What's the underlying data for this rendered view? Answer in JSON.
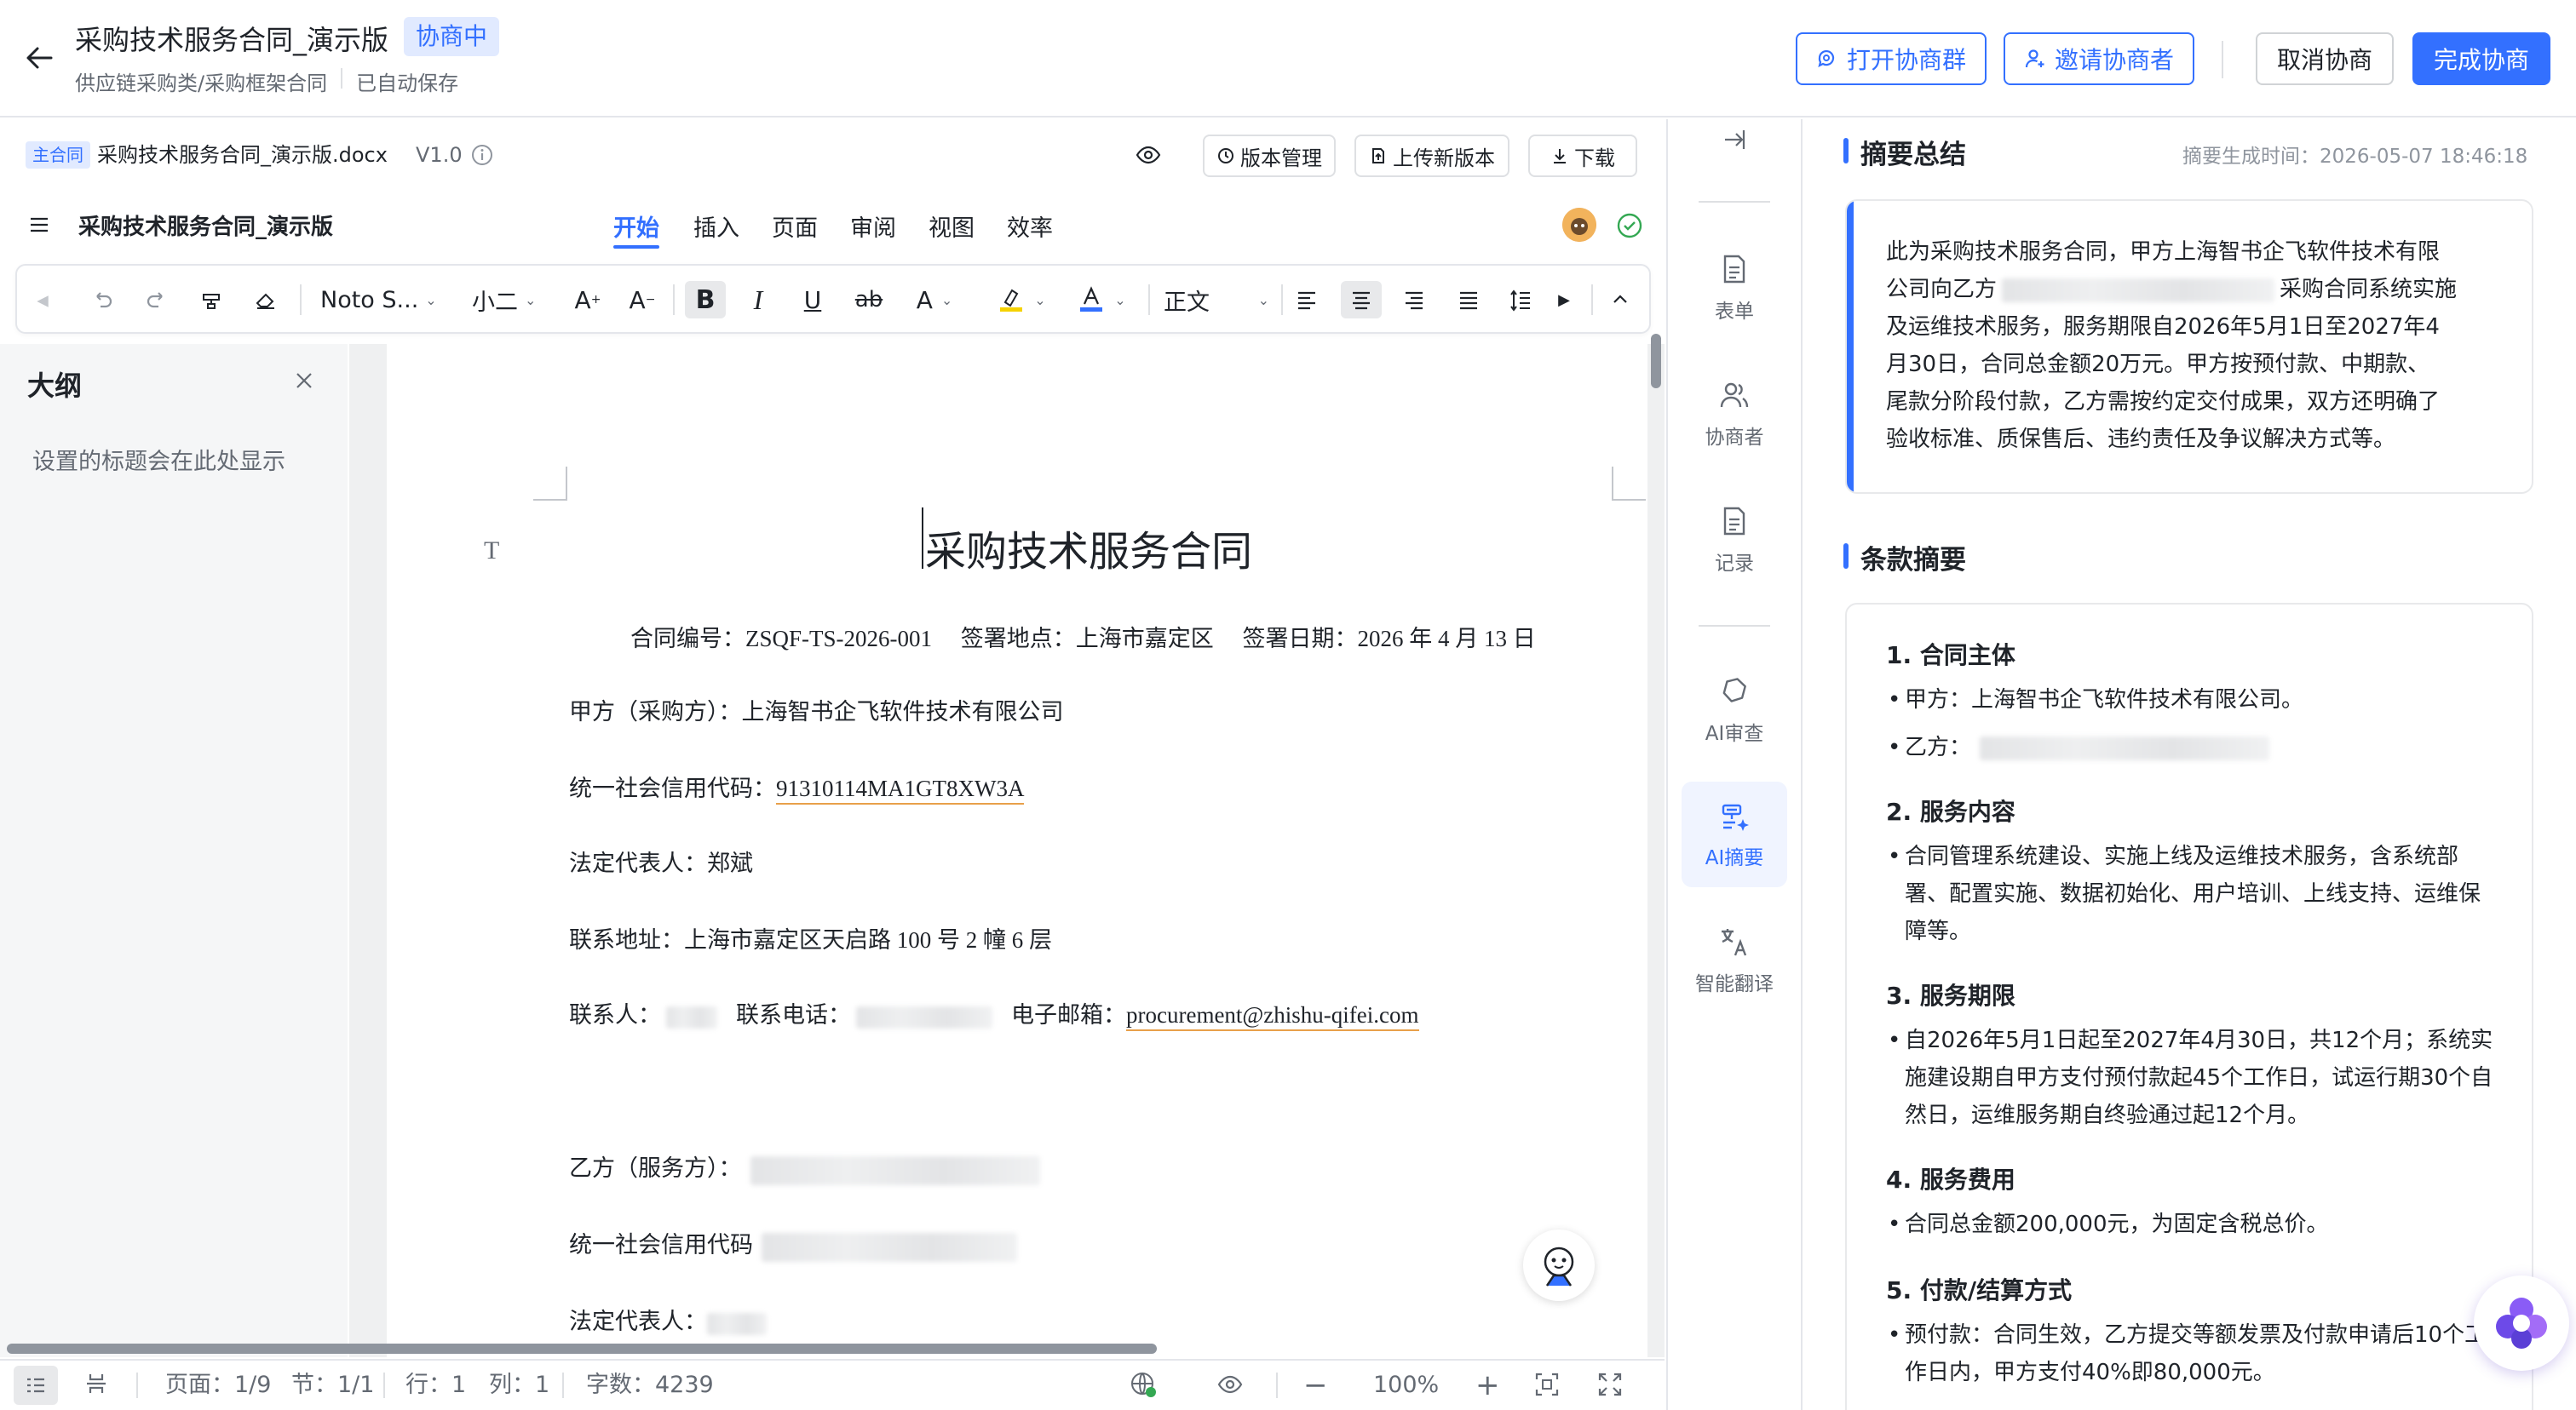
{
  "header": {
    "title": "采购技术服务合同_演示版",
    "status": "协商中",
    "category": "供应链采购类/采购框架合同",
    "save_state": "已自动保存",
    "buttons": {
      "open_group": "打开协商群",
      "invite": "邀请协商者",
      "cancel": "取消协商",
      "complete": "完成协商"
    }
  },
  "docbar": {
    "main_tag": "主合同",
    "file_name": "采购技术服务合同_演示版.docx",
    "version": "V1.0",
    "version_mgmt": "版本管理",
    "upload_version": "上传新版本",
    "download": "下载"
  },
  "editor": {
    "doc_name": "采购技术服务合同_演示版",
    "tabs": [
      "开始",
      "插入",
      "页面",
      "审阅",
      "视图",
      "效率"
    ],
    "active_tab": "开始",
    "toolbar": {
      "font": "Noto S...",
      "size": "小二",
      "style": "正文"
    }
  },
  "outline": {
    "title": "大纲",
    "hint": "设置的标题会在此处显示"
  },
  "document": {
    "title": "采购技术服务合同",
    "meta_line": "合同编号：ZSQF-TS-2026-001　 签署地点：上海市嘉定区　 签署日期：2026 年 4 月 13 日",
    "party_a": "甲方（采购方）：上海智书企飞软件技术有限公司",
    "credit_code_label": "统一社会信用代码：",
    "credit_code_value": "91310114MA1GT8XW3A",
    "legal_rep": "法定代表人：郑斌",
    "address": "联系地址：上海市嘉定区天启路 100 号 2 幢 6 层",
    "contact_label": "联系人：",
    "phone_label": "联系电话：",
    "email_label": "电子邮箱：",
    "email_value": "procurement@zhishu-qifei.com",
    "party_b_label": "乙方（服务方）：",
    "party_b_credit_label": "统一社会信用代码",
    "party_b_legal_label": "法定代表人："
  },
  "statusbar": {
    "page": "页面：1/9",
    "section": "节：1/1",
    "row": "行：1",
    "col": "列：1",
    "words": "字数：4239",
    "zoom": "100%"
  },
  "rail": {
    "form": "表单",
    "negotiators": "协商者",
    "record": "记录",
    "ai_review": "AI审查",
    "ai_summary": "AI摘要",
    "translate": "智能翻译"
  },
  "summary": {
    "title": "摘要总结",
    "time": "摘要生成时间：2026-05-07 18:46:18",
    "text_1": "此为采购技术服务合同，甲方上海智书企飞软件技术有限",
    "text_2a": "公司向乙方",
    "text_2b": "采购合同系统实施",
    "text_3": "及运维技术服务，服务期限自2026年5月1日至2027年4",
    "text_4": "月30日，合同总金额20万元。甲方按预付款、中期款、",
    "text_5": "尾款分阶段付款，乙方需按约定交付成果，双方还明确了",
    "text_6": "验收标准、质保售后、违约责任及争议解决方式等。",
    "terms_title": "条款摘要",
    "terms": {
      "t1_h": "1. 合同主体",
      "t1_b1": "甲方：上海智书企飞软件技术有限公司。",
      "t1_b2": "乙方：",
      "t2_h": "2. 服务内容",
      "t2_b1": "合同管理系统建设、实施上线及运维技术服务，含系统部署、配置实施、数据初始化、用户培训、上线支持、运维保障等。",
      "t3_h": "3. 服务期限",
      "t3_b1": "自2026年5月1日起至2027年4月30日，共12个月；系统实施建设期自甲方支付预付款起45个工作日，试运行期30个自然日，运维服务期自终验通过起12个月。",
      "t4_h": "4. 服务费用",
      "t4_b1": "合同总金额200,000元，为固定含税总价。",
      "t5_h": "5. 付款/结算方式",
      "t5_b1": "预付款：合同生效，乙方提交等额发票及付款申请后10个工作日内，甲方支付40%即80,000元。"
    }
  },
  "colors": {
    "accent": "#3370ff",
    "badge_bg": "#e1eaff",
    "canvas": "#eff0f1",
    "outline_bg": "#f5f6f7"
  }
}
